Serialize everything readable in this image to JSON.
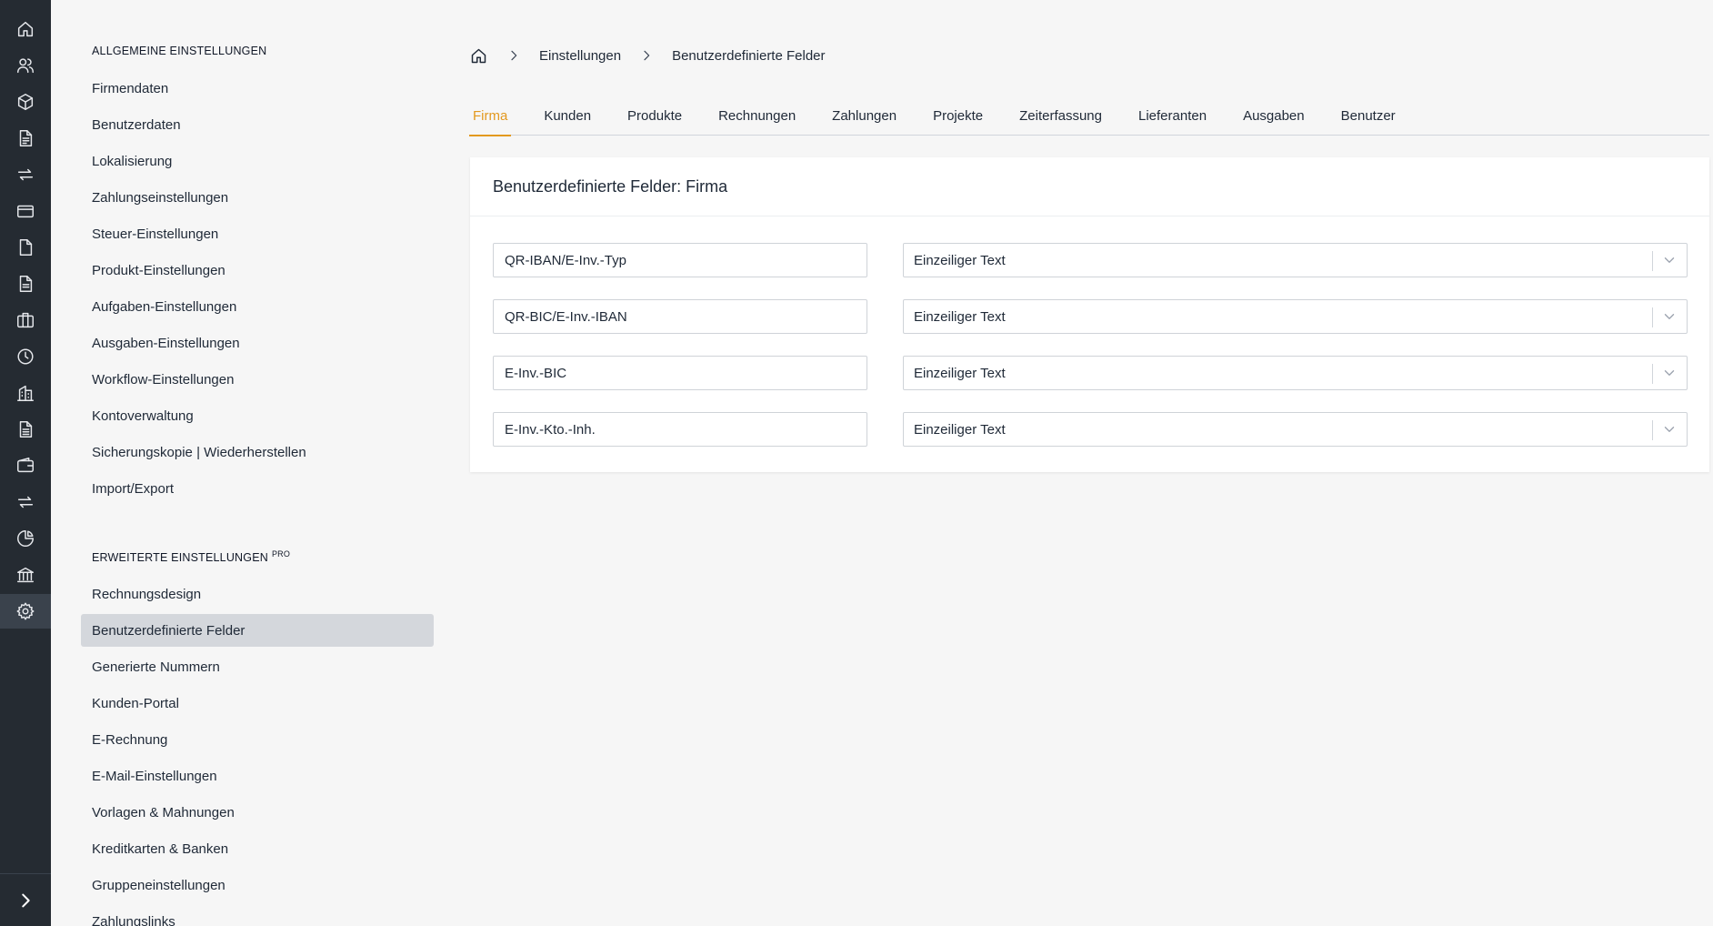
{
  "rail": {
    "icons": [
      "home-icon",
      "users-icon",
      "box-icon",
      "file-text-icon",
      "repeat-icon",
      "credit-card-icon",
      "file-icon",
      "file-lines-icon",
      "briefcase-icon",
      "clock-icon",
      "building-icon",
      "file-list-icon",
      "wallet-icon",
      "transfer-icon",
      "pie-chart-icon",
      "bank-icon",
      "settings-icon"
    ],
    "active": "settings-icon"
  },
  "settings_nav": {
    "general_title": "ALLGEMEINE EINSTELLUNGEN",
    "general_items": [
      "Firmendaten",
      "Benutzerdaten",
      "Lokalisierung",
      "Zahlungseinstellungen",
      "Steuer-Einstellungen",
      "Produkt-Einstellungen",
      "Aufgaben-Einstellungen",
      "Ausgaben-Einstellungen",
      "Workflow-Einstellungen",
      "Kontoverwaltung",
      "Sicherungskopie | Wiederherstellen",
      "Import/Export"
    ],
    "advanced_title": "ERWEITERTE EINSTELLUNGEN",
    "advanced_badge": "PRO",
    "advanced_items": [
      "Rechnungsdesign",
      "Benutzerdefinierte Felder",
      "Generierte Nummern",
      "Kunden-Portal",
      "E-Rechnung",
      "E-Mail-Einstellungen",
      "Vorlagen & Mahnungen",
      "Kreditkarten & Banken",
      "Gruppeneinstellungen",
      "Zahlungslinks"
    ],
    "active_item": "Benutzerdefinierte Felder"
  },
  "breadcrumb": {
    "items": [
      "Einstellungen",
      "Benutzerdefinierte Felder"
    ]
  },
  "tabs": {
    "items": [
      "Firma",
      "Kunden",
      "Produkte",
      "Rechnungen",
      "Zahlungen",
      "Projekte",
      "Zeiterfassung",
      "Lieferanten",
      "Ausgaben",
      "Benutzer"
    ],
    "active": "Firma"
  },
  "card": {
    "title": "Benutzerdefinierte Felder: Firma",
    "fields": [
      {
        "label": "QR-IBAN/E-Inv.-Typ",
        "type": "Einzeiliger Text"
      },
      {
        "label": "QR-BIC/E-Inv.-IBAN",
        "type": "Einzeiliger Text"
      },
      {
        "label": "E-Inv.-BIC",
        "type": "Einzeiliger Text"
      },
      {
        "label": "E-Inv.-Kto.-Inh.",
        "type": "Einzeiliger Text"
      }
    ]
  },
  "colors": {
    "rail_bg": "#252b32",
    "accent": "#e3991f",
    "active_nav_bg": "#d4d7dc"
  }
}
